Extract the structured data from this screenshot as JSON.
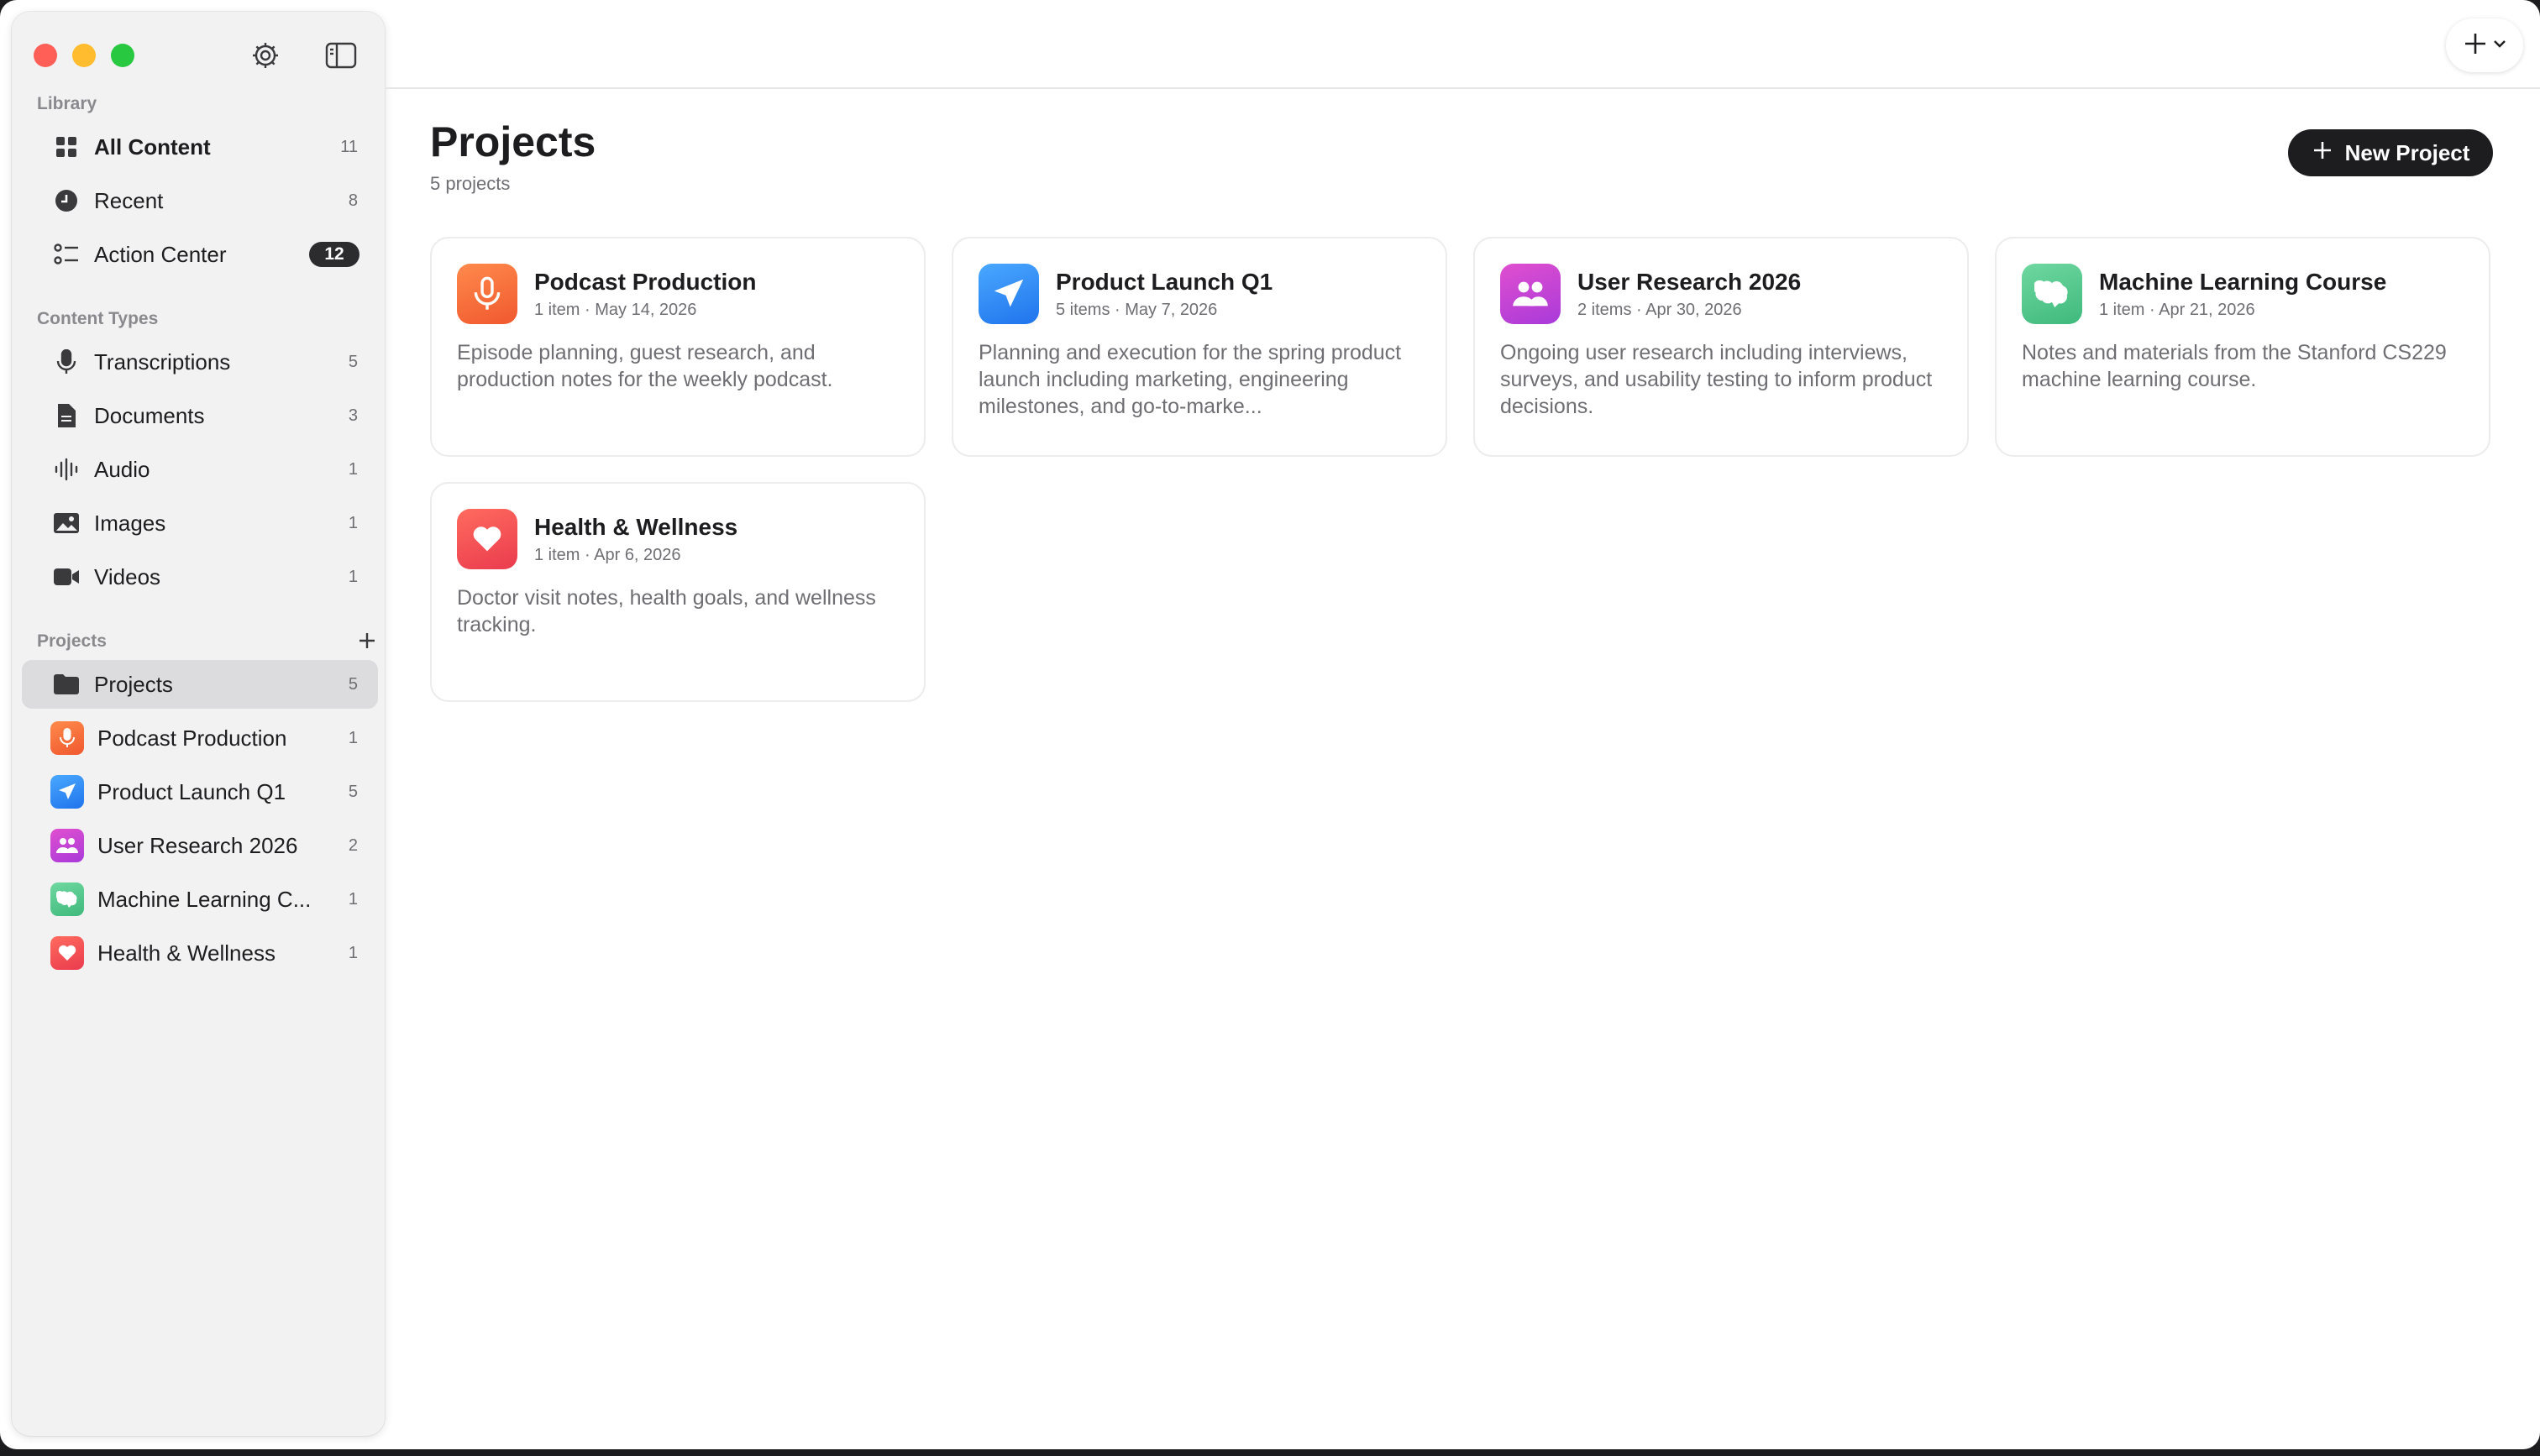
{
  "sidebar": {
    "library_label": "Library",
    "library": [
      {
        "label": "All Content",
        "count": "11"
      },
      {
        "label": "Recent",
        "count": "8"
      },
      {
        "label": "Action Center",
        "count": "12"
      }
    ],
    "content_types_label": "Content Types",
    "content_types": [
      {
        "label": "Transcriptions",
        "count": "5"
      },
      {
        "label": "Documents",
        "count": "3"
      },
      {
        "label": "Audio",
        "count": "1"
      },
      {
        "label": "Images",
        "count": "1"
      },
      {
        "label": "Videos",
        "count": "1"
      }
    ],
    "projects_label": "Projects",
    "projects_root": {
      "label": "Projects",
      "count": "5"
    },
    "projects": [
      {
        "label": "Podcast Production",
        "count": "1",
        "icon": "microphone-icon",
        "color": "#f26b3a"
      },
      {
        "label": "Product Launch Q1",
        "count": "5",
        "icon": "paper-plane-icon",
        "color": "#2f86f4"
      },
      {
        "label": "User Research 2026",
        "count": "2",
        "icon": "people-icon",
        "color": "#c444d6"
      },
      {
        "label": "Machine Learning C...",
        "count": "1",
        "icon": "brain-icon",
        "color": "#53c78b"
      },
      {
        "label": "Health & Wellness",
        "count": "1",
        "icon": "heart-icon",
        "color": "#f24a52"
      }
    ]
  },
  "main": {
    "title": "Projects",
    "subtitle": "5 projects",
    "new_project_label": "New Project",
    "cards": [
      {
        "title": "Podcast Production",
        "meta": "1 item · May 14, 2026",
        "description": "Episode planning, guest research, and production notes for the weekly podcast.",
        "icon": "microphone-icon"
      },
      {
        "title": "Product Launch Q1",
        "meta": "5 items · May 7, 2026",
        "description": "Planning and execution for the spring product launch including marketing, engineering milestones, and go-to-marke...",
        "icon": "paper-plane-icon"
      },
      {
        "title": "User Research 2026",
        "meta": "2 items · Apr 30, 2026",
        "description": "Ongoing user research including interviews, surveys, and usability testing to inform product decisions.",
        "icon": "people-icon"
      },
      {
        "title": "Machine Learning Course",
        "meta": "1 item · Apr 21, 2026",
        "description": "Notes and materials from the Stanford CS229 machine learning course.",
        "icon": "brain-icon"
      },
      {
        "title": "Health & Wellness",
        "meta": "1 item · Apr 6, 2026",
        "description": "Doctor visit notes, health goals, and wellness tracking.",
        "icon": "heart-icon"
      }
    ]
  },
  "colors": {
    "accent_dark": "#1d1d1f",
    "selected_row": "#dcdcde",
    "sidebar_bg": "#f2f2f3"
  }
}
